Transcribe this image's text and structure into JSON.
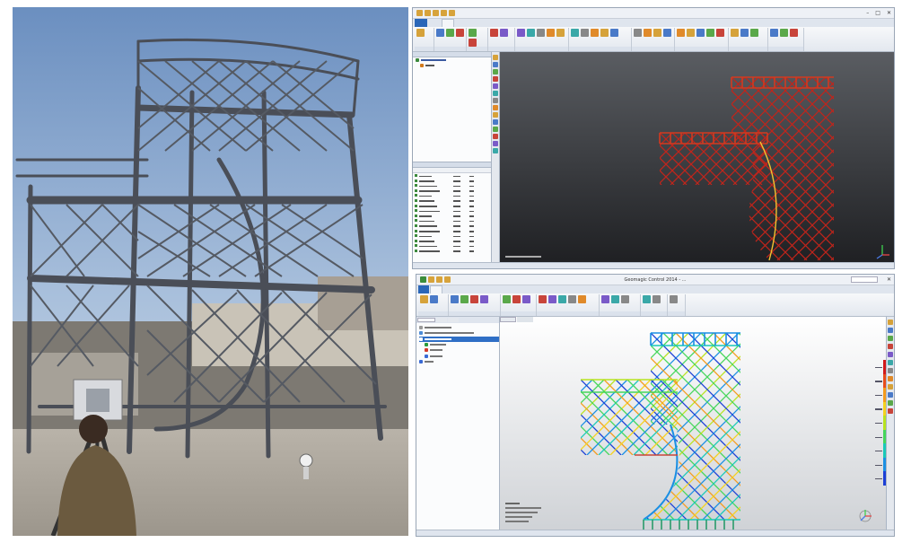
{
  "colors": {
    "scan_red": "#c2251b",
    "scan_yellow": "#f1c232",
    "dark_viewport_top": "#5a5d62",
    "dark_viewport_bottom": "#1f2023",
    "light_viewport_top": "#ffffff",
    "light_viewport_bottom": "#cfd2d6",
    "ribbon_blue": "#2a66b8"
  },
  "window_top": {
    "ribbon_tab_icons": [
      "sun-icon",
      "save-icon",
      "undo-icon",
      "redo-icon"
    ],
    "statusbar_ruler": "ruler-icon"
  },
  "window_bottom": {
    "title": "Geomagic Control 2014 - ...",
    "search_placeholder": ""
  },
  "legend": {
    "colors": [
      "#d21a1a",
      "#e84d1b",
      "#f49b1d",
      "#f4d21f",
      "#b7e31f",
      "#45d65a",
      "#19c9b8",
      "#1a8fe3",
      "#1b3fd6"
    ]
  }
}
